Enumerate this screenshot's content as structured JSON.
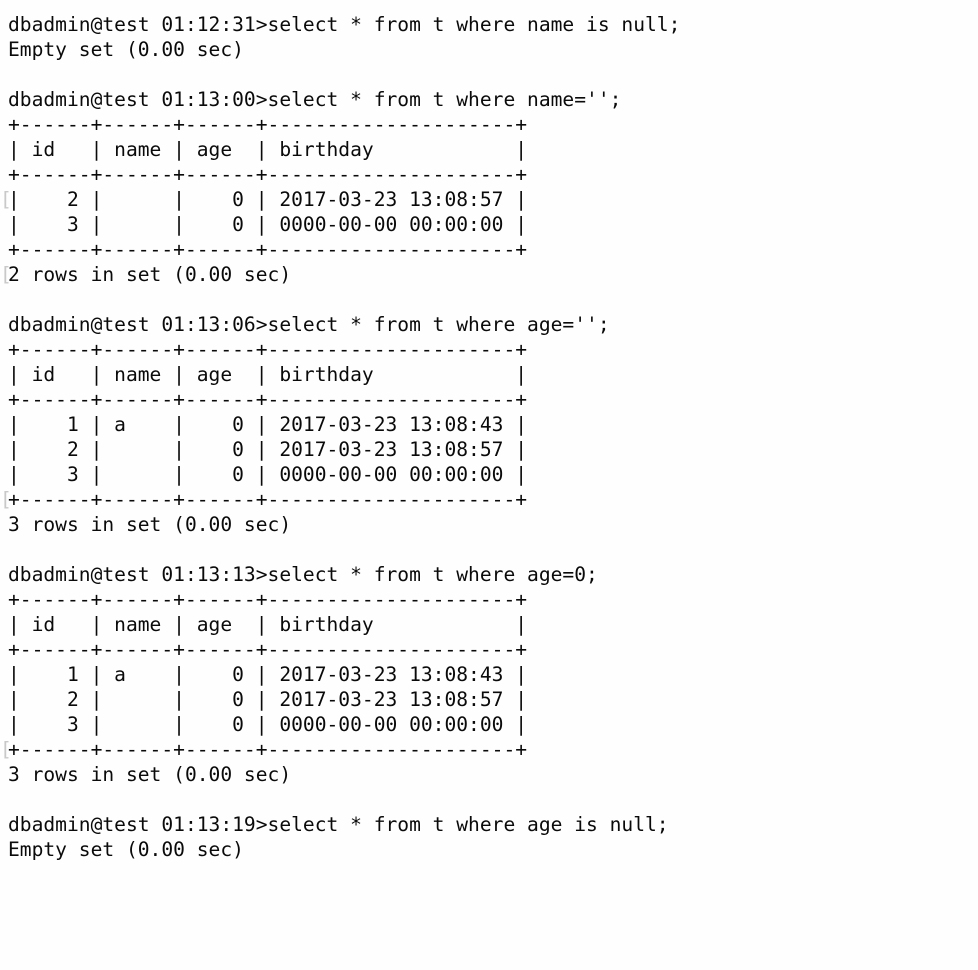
{
  "terminal": {
    "app": "mysql-client",
    "prompt_user": "dbadmin",
    "prompt_host": "test",
    "colors": {
      "background": "#fefefe",
      "foreground": "#0a0a0a",
      "artifact": "#c9c9c9"
    },
    "table_columns": [
      "id",
      "name",
      "age",
      "birthday"
    ],
    "separator": "+------+------+------+---------------------+",
    "header_row": "| id   | name | age  | birthday            |",
    "lines": [
      {
        "text": "dbadmin@test 01:12:31>select * from t where name is null;",
        "kind": "prompt",
        "artifact": false
      },
      {
        "text": "Empty set (0.00 sec)",
        "kind": "status",
        "artifact": false
      },
      {
        "text": "",
        "kind": "blank",
        "artifact": false
      },
      {
        "text": "dbadmin@test 01:13:00>select * from t where name='';",
        "kind": "prompt",
        "artifact": false
      },
      {
        "text": "+------+------+------+---------------------+",
        "kind": "separator",
        "artifact": false
      },
      {
        "text": "| id   | name | age  | birthday            |",
        "kind": "header",
        "artifact": false
      },
      {
        "text": "+------+------+------+---------------------+",
        "kind": "separator",
        "artifact": false
      },
      {
        "text": "|    2 |      |    0 | 2017-03-23 13:08:57 |",
        "kind": "row",
        "artifact": true
      },
      {
        "text": "|    3 |      |    0 | 0000-00-00 00:00:00 |",
        "kind": "row",
        "artifact": false
      },
      {
        "text": "+------+------+------+---------------------+",
        "kind": "separator",
        "artifact": false
      },
      {
        "text": "2 rows in set (0.00 sec)",
        "kind": "status",
        "artifact": true
      },
      {
        "text": "",
        "kind": "blank",
        "artifact": false
      },
      {
        "text": "dbadmin@test 01:13:06>select * from t where age='';",
        "kind": "prompt",
        "artifact": false
      },
      {
        "text": "+------+------+------+---------------------+",
        "kind": "separator",
        "artifact": false
      },
      {
        "text": "| id   | name | age  | birthday            |",
        "kind": "header",
        "artifact": false
      },
      {
        "text": "+------+------+------+---------------------+",
        "kind": "separator",
        "artifact": false
      },
      {
        "text": "|    1 | a    |    0 | 2017-03-23 13:08:43 |",
        "kind": "row",
        "artifact": false
      },
      {
        "text": "|    2 |      |    0 | 2017-03-23 13:08:57 |",
        "kind": "row",
        "artifact": false
      },
      {
        "text": "|    3 |      |    0 | 0000-00-00 00:00:00 |",
        "kind": "row",
        "artifact": false
      },
      {
        "text": "+------+------+------+---------------------+",
        "kind": "separator",
        "artifact": true
      },
      {
        "text": "3 rows in set (0.00 sec)",
        "kind": "status",
        "artifact": false
      },
      {
        "text": "",
        "kind": "blank",
        "artifact": false
      },
      {
        "text": "dbadmin@test 01:13:13>select * from t where age=0;",
        "kind": "prompt",
        "artifact": false
      },
      {
        "text": "+------+------+------+---------------------+",
        "kind": "separator",
        "artifact": false
      },
      {
        "text": "| id   | name | age  | birthday            |",
        "kind": "header",
        "artifact": false
      },
      {
        "text": "+------+------+------+---------------------+",
        "kind": "separator",
        "artifact": false
      },
      {
        "text": "|    1 | a    |    0 | 2017-03-23 13:08:43 |",
        "kind": "row",
        "artifact": false
      },
      {
        "text": "|    2 |      |    0 | 2017-03-23 13:08:57 |",
        "kind": "row",
        "artifact": false
      },
      {
        "text": "|    3 |      |    0 | 0000-00-00 00:00:00 |",
        "kind": "row",
        "artifact": false
      },
      {
        "text": "+------+------+------+---------------------+",
        "kind": "separator",
        "artifact": true
      },
      {
        "text": "3 rows in set (0.00 sec)",
        "kind": "status",
        "artifact": false
      },
      {
        "text": "",
        "kind": "blank",
        "artifact": false
      },
      {
        "text": "dbadmin@test 01:13:19>select * from t where age is null;",
        "kind": "prompt",
        "artifact": false
      },
      {
        "text": "Empty set (0.00 sec)",
        "kind": "status",
        "artifact": false
      }
    ],
    "queries": [
      {
        "timestamp": "01:12:31",
        "sql": "select * from t where name is null;",
        "result": "Empty set (0.00 sec)",
        "rows": []
      },
      {
        "timestamp": "01:13:00",
        "sql": "select * from t where name='';",
        "result": "2 rows in set (0.00 sec)",
        "rows": [
          {
            "id": "2",
            "name": "",
            "age": "0",
            "birthday": "2017-03-23 13:08:57"
          },
          {
            "id": "3",
            "name": "",
            "age": "0",
            "birthday": "0000-00-00 00:00:00"
          }
        ]
      },
      {
        "timestamp": "01:13:06",
        "sql": "select * from t where age='';",
        "result": "3 rows in set (0.00 sec)",
        "rows": [
          {
            "id": "1",
            "name": "a",
            "age": "0",
            "birthday": "2017-03-23 13:08:43"
          },
          {
            "id": "2",
            "name": "",
            "age": "0",
            "birthday": "2017-03-23 13:08:57"
          },
          {
            "id": "3",
            "name": "",
            "age": "0",
            "birthday": "0000-00-00 00:00:00"
          }
        ]
      },
      {
        "timestamp": "01:13:13",
        "sql": "select * from t where age=0;",
        "result": "3 rows in set (0.00 sec)",
        "rows": [
          {
            "id": "1",
            "name": "a",
            "age": "0",
            "birthday": "2017-03-23 13:08:43"
          },
          {
            "id": "2",
            "name": "",
            "age": "0",
            "birthday": "2017-03-23 13:08:57"
          },
          {
            "id": "3",
            "name": "",
            "age": "0",
            "birthday": "0000-00-00 00:00:00"
          }
        ]
      },
      {
        "timestamp": "01:13:19",
        "sql": "select * from t where age is null;",
        "result": "Empty set (0.00 sec)",
        "rows": []
      }
    ]
  }
}
